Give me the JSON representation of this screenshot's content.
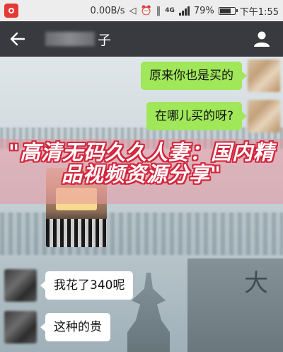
{
  "status_bar": {
    "speed": "0.00B/s",
    "network": "4G",
    "battery": "79%",
    "time": "下午1:55"
  },
  "header": {
    "title_suffix": "子"
  },
  "messages": [
    {
      "side": "right",
      "type": "text",
      "text": "原来你也是买的"
    },
    {
      "side": "right",
      "type": "text",
      "text": "在哪儿买的呀?"
    },
    {
      "side": "left",
      "type": "image"
    },
    {
      "side": "left",
      "type": "text",
      "text": "我花了340呢"
    },
    {
      "side": "left",
      "type": "text",
      "text": "这种的贵"
    }
  ],
  "overlay": {
    "headline": "\"高清无码久久人妻：国内精品视频资源分享\""
  },
  "colors": {
    "header_bg": "#393a3f",
    "sent_bubble": "#a0e75a",
    "received_bubble": "#ffffff",
    "banner_accent": "#d4263d"
  }
}
